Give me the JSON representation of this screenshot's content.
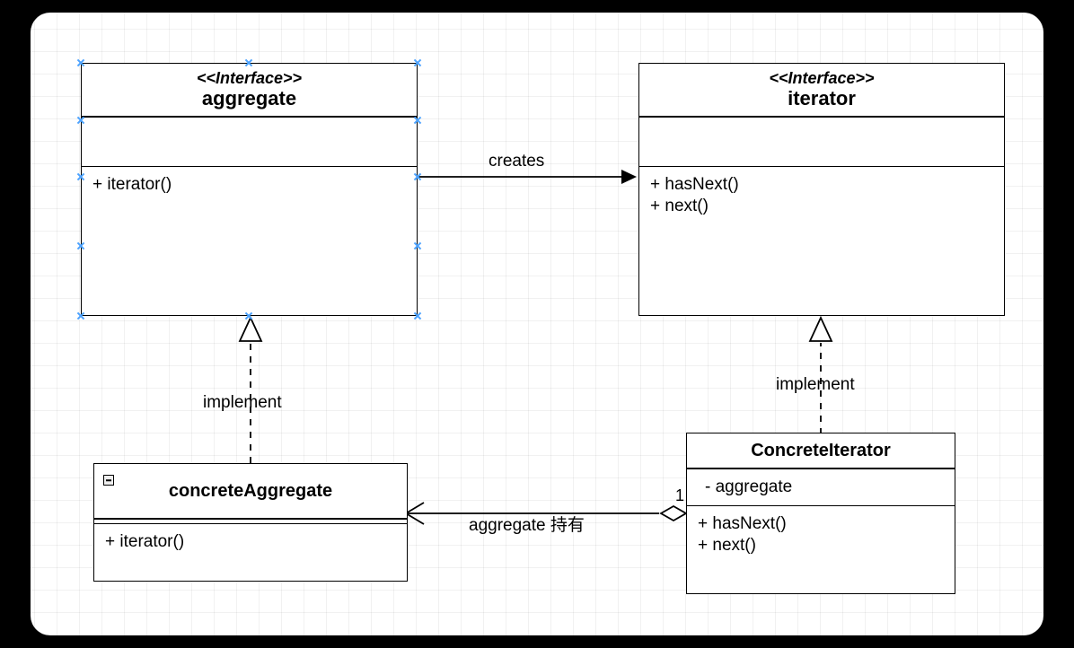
{
  "classes": {
    "aggregate": {
      "stereotype": "<<Interface>>",
      "name": "aggregate",
      "ops": [
        "+ iterator()"
      ]
    },
    "iterator": {
      "stereotype": "<<Interface>>",
      "name": "iterator",
      "ops": [
        "+ hasNext()",
        "+ next()"
      ]
    },
    "concreteAggregate": {
      "name": "concreteAggregate",
      "ops": [
        "+ iterator()"
      ]
    },
    "concreteIterator": {
      "name": "ConcreteIterator",
      "attrs": [
        "- aggregate"
      ],
      "ops": [
        "+ hasNext()",
        "+ next()"
      ]
    }
  },
  "edges": {
    "creates": "creates",
    "implementLeft": "implement",
    "implementRight": "implement",
    "aggregateHolds": "aggregate 持有",
    "aggregateMult": "1"
  }
}
